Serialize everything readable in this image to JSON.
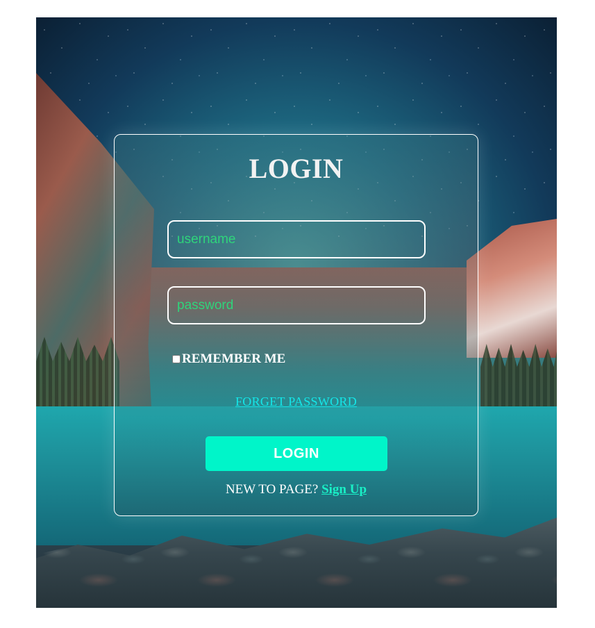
{
  "login_form": {
    "title": "LOGIN",
    "username_placeholder": "username",
    "password_placeholder": "password",
    "remember_label": "REMEMBER ME",
    "remember_checked": false,
    "forgot_link": "FORGET PASSWORD",
    "submit_label": "LOGIN",
    "signup_prompt": "NEW TO PAGE?",
    "signup_link": "Sign Up"
  },
  "colors": {
    "accent_button": "#00f5c9",
    "input_text": "#2fd47b",
    "forgot_link": "#14e6e8",
    "signup_link": "#19f0c6"
  }
}
